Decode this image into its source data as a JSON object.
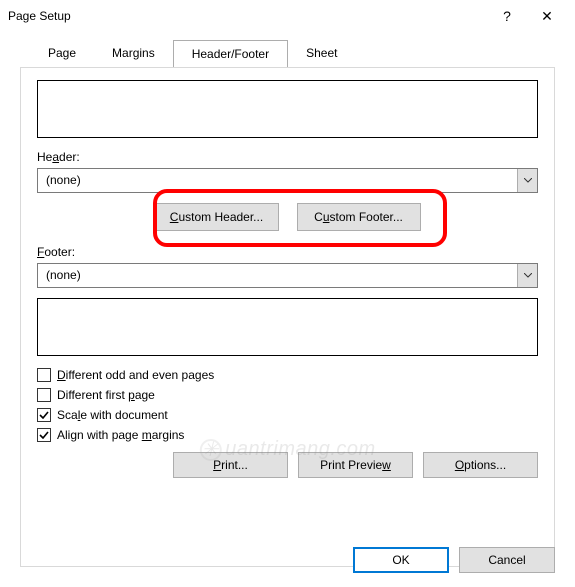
{
  "window": {
    "title": "Page Setup",
    "help": "?",
    "close": "✕"
  },
  "tabs": {
    "page": "Page",
    "margins": "Margins",
    "headerfooter": "Header/Footer",
    "sheet": "Sheet",
    "active": "headerfooter"
  },
  "labels": {
    "header": "Header:",
    "footer": "Footer:"
  },
  "selects": {
    "header_value": "(none)",
    "footer_value": "(none)"
  },
  "buttons": {
    "custom_header": "Custom Header...",
    "custom_footer": "Custom Footer...",
    "print": "Print...",
    "print_preview": "Print Preview",
    "options": "Options...",
    "ok": "OK",
    "cancel": "Cancel"
  },
  "checkboxes": {
    "diff_odd_even": {
      "label": "Different odd and even pages",
      "checked": false
    },
    "diff_first": {
      "label": "Different first page",
      "checked": false
    },
    "scale_doc": {
      "label": "Scale with document",
      "checked": true
    },
    "align_margins": {
      "label": "Align with page margins",
      "checked": true
    }
  },
  "watermark": "uantrimang.com"
}
